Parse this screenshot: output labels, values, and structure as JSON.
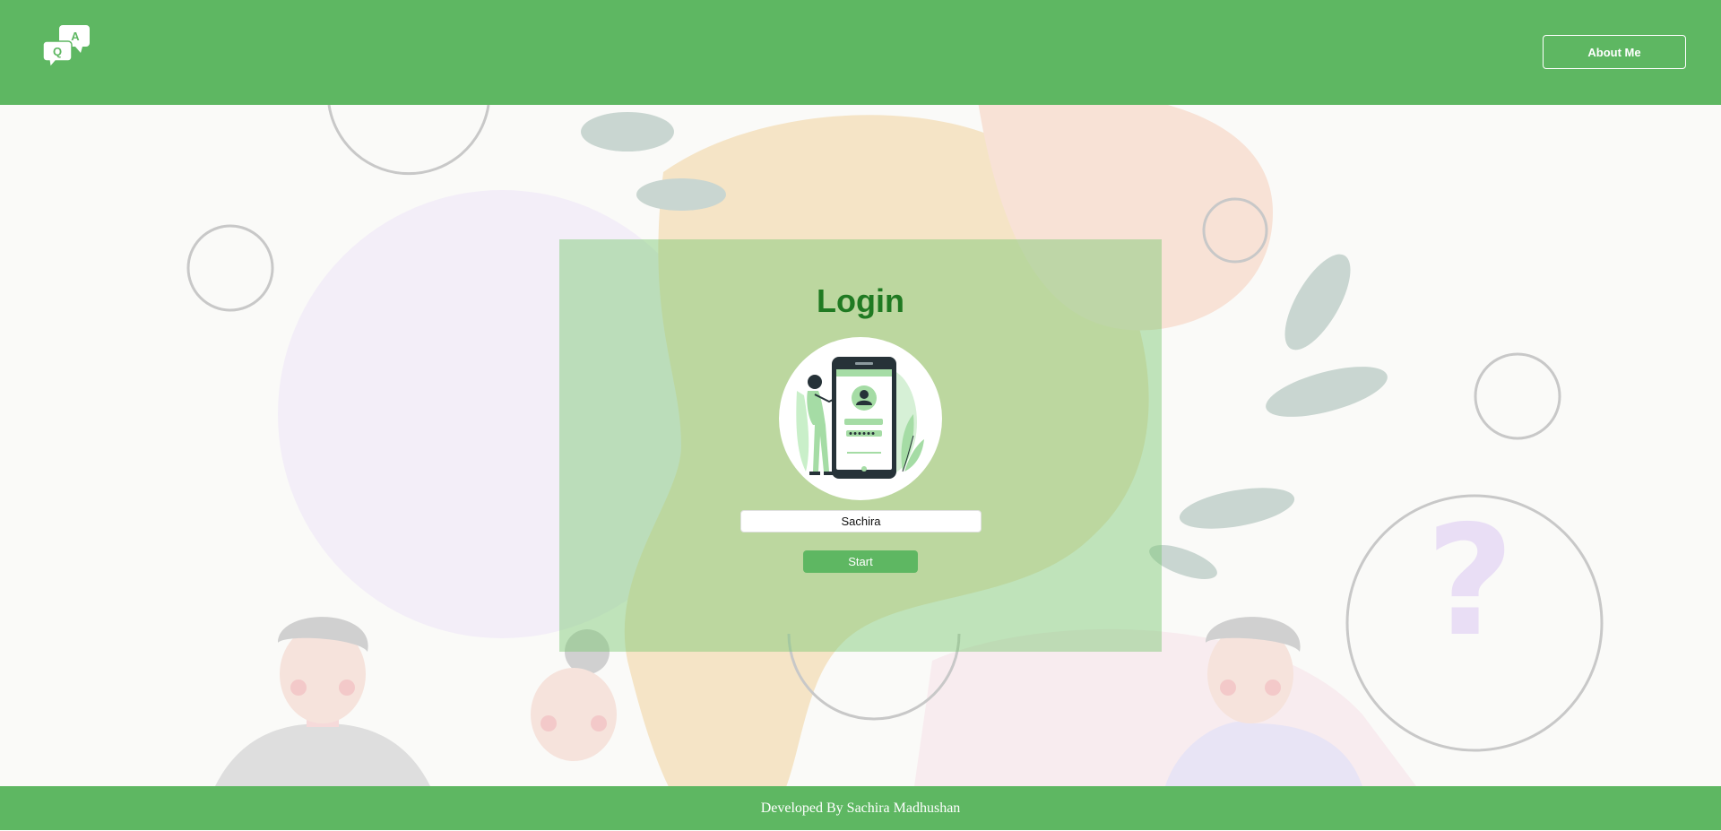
{
  "header": {
    "logo_icon": "qa-chat-bubbles-icon",
    "logo_letters": [
      "Q",
      "A"
    ],
    "about_label": "About Me"
  },
  "login": {
    "title": "Login",
    "illustration": "person-with-phone-login-icon",
    "name_value": "Sachira",
    "start_label": "Start"
  },
  "footer": {
    "text": "Developed By Sachira Madhushan"
  },
  "colors": {
    "brand_green": "#5eb762",
    "title_green": "#207a22",
    "card_overlay": "rgba(120,200,110,0.45)"
  }
}
